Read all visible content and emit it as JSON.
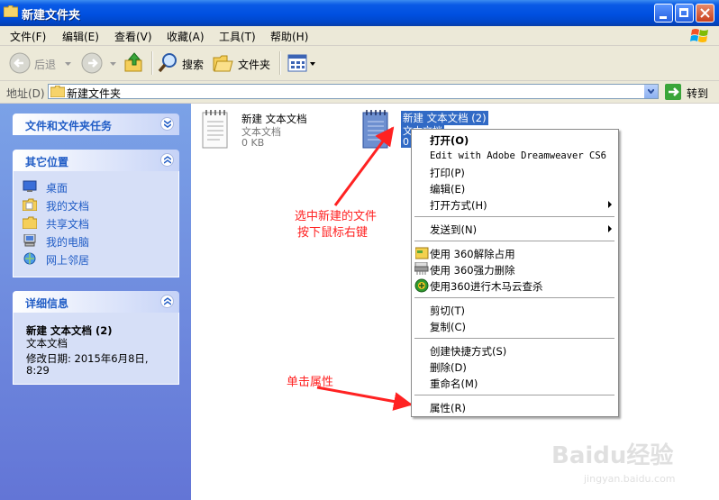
{
  "window": {
    "title": "新建文件夹"
  },
  "menubar": {
    "items": [
      "文件(F)",
      "编辑(E)",
      "查看(V)",
      "收藏(A)",
      "工具(T)",
      "帮助(H)"
    ]
  },
  "toolbar": {
    "back": "后退",
    "search": "搜索",
    "folders": "文件夹"
  },
  "address": {
    "label": "地址(D)",
    "value": "新建文件夹",
    "go": "转到"
  },
  "tasks": {
    "file_tasks_title": "文件和文件夹任务",
    "other_places_title": "其它位置",
    "other_places": [
      "桌面",
      "我的文档",
      "共享文档",
      "我的电脑",
      "网上邻居"
    ],
    "details_title": "详细信息",
    "details_name": "新建 文本文档 (2)",
    "details_type": "文本文档",
    "details_modified": "修改日期: 2015年6月8日,",
    "details_time": "8:29"
  },
  "files": [
    {
      "name": "新建 文本文档",
      "type": "文本文档",
      "size": "0 KB"
    },
    {
      "name": "新建 文本文档 (2)",
      "type": "文本文档",
      "size": "0"
    }
  ],
  "context_menu": {
    "open": "打开(O)",
    "edit_dw": "Edit with Adobe Dreamweaver CS6",
    "print": "打印(P)",
    "edit": "编辑(E)",
    "open_with": "打开方式(H)",
    "send_to": "发送到(N)",
    "unlock_360": "使用 360解除占用",
    "shred_360": "使用 360强力删除",
    "scan_360": "使用360进行木马云查杀",
    "cut": "剪切(T)",
    "copy": "复制(C)",
    "shortcut": "创建快捷方式(S)",
    "delete": "删除(D)",
    "rename": "重命名(M)",
    "properties": "属性(R)"
  },
  "annotations": {
    "select_line1": "选中新建的文件",
    "select_line2": "按下鼠标右键",
    "click_properties": "单击属性"
  },
  "watermark": {
    "brand": "Baidu经验",
    "url": "jingyan.baidu.com"
  },
  "colors": {
    "titlebar": "#0050e0",
    "taskpane": "#6f8de0",
    "selection": "#316ac5",
    "annotation": "#ff2222"
  }
}
